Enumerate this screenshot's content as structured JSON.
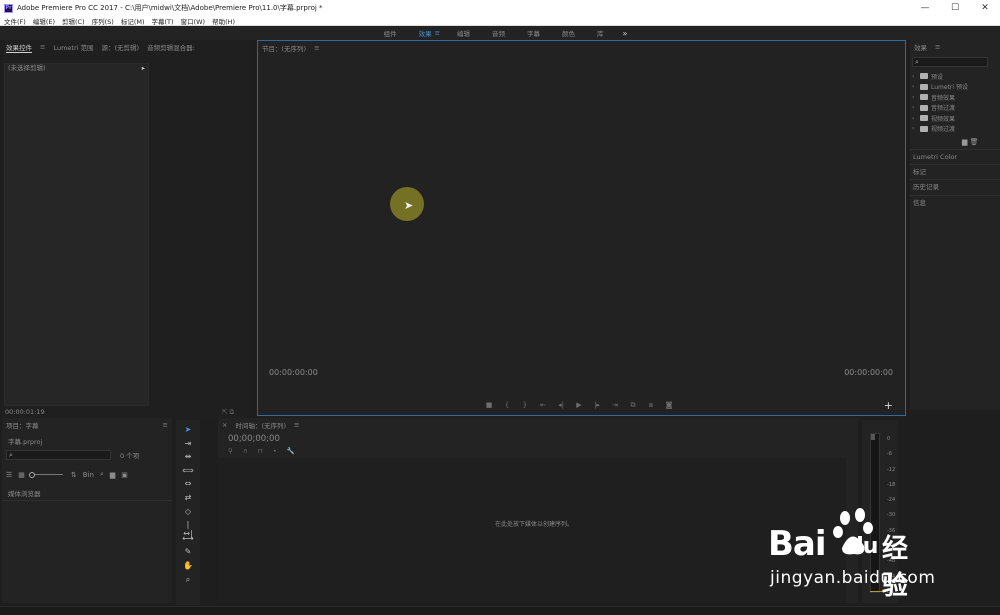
{
  "window": {
    "title": "Adobe Premiere Pro CC 2017 - C:\\用户\\midwi\\文档\\Adobe\\Premiere Pro\\11.0\\字幕.prproj *",
    "app_icon": "Pr",
    "controls": [
      "—",
      "☐",
      "✕"
    ]
  },
  "menu": [
    "文件(F)",
    "编辑(E)",
    "剪辑(C)",
    "序列(S)",
    "标记(M)",
    "字幕(T)",
    "窗口(W)",
    "帮助(H)"
  ],
  "workspaces": {
    "items": [
      "组件",
      "效果",
      "编辑",
      "音频",
      "字幕",
      "颜色",
      "库"
    ],
    "active": "效果",
    "menu_glyph": "≡",
    "more": "»"
  },
  "effect_controls": {
    "tabs": [
      "效果控件",
      "≡",
      "Lumetri 范围",
      "源：(无剪辑)",
      "音频剪辑混合器:"
    ],
    "header": "(未选择剪辑)",
    "header_arrow": "▸",
    "timecode": "00:00:01:19",
    "footer_icons": "⇱ ⧉"
  },
  "program_monitor": {
    "title": "节目：(无序列)",
    "menu": "≡",
    "tc_left": "00:00:00:00",
    "tc_right": "00:00:00:00",
    "transport": [
      "■",
      "{",
      "}",
      "⇤",
      "◂|",
      "▶",
      "|▸",
      "⇥",
      "⧉",
      "⧈",
      "◙"
    ],
    "plus": "+"
  },
  "effects": {
    "title": "效果",
    "menu": "≡",
    "search_glyph": "⌕",
    "tree": [
      "预设",
      "Lumetri 预设",
      "音频效果",
      "音频过渡",
      "视频效果",
      "视频过渡"
    ],
    "bottom_icons": "▆ 🗑",
    "sections": [
      "Lumetri Color",
      "标记",
      "历史记录",
      "信息"
    ]
  },
  "project": {
    "title": "项目：字幕",
    "menu": "≡",
    "file": "字幕.prproj",
    "search_glyph": "⌕",
    "count": "0 个项",
    "toolbar_icons": [
      "☰",
      "▦",
      "⇅",
      "Bin",
      "⌕",
      "▆",
      "▣"
    ],
    "media_browser": "媒体浏览器"
  },
  "tools": [
    "➤",
    "⇥",
    "⇹",
    "⟺",
    "⇔",
    "⇄",
    "◇",
    "|↔|",
    "⟷",
    "✎",
    "✋",
    "⌕"
  ],
  "timeline": {
    "close": "×",
    "title": "时间轴：(无序列)",
    "menu": "≡",
    "timecode": "00;00;00;00",
    "icons": [
      "⚲",
      "∩",
      "⊓",
      "•",
      "🔧"
    ],
    "empty_message": "在此处放下媒体以创建序列。"
  },
  "audio_meter": {
    "scale": [
      "0",
      "-6",
      "-12",
      "-18",
      "-24",
      "-30",
      "-36",
      "-42",
      "-48",
      "-54",
      "dB"
    ]
  },
  "watermark": {
    "brand": "Bai",
    "brand_suffix": "du",
    "cn": "经验",
    "url": "jingyan.baidu.com"
  }
}
